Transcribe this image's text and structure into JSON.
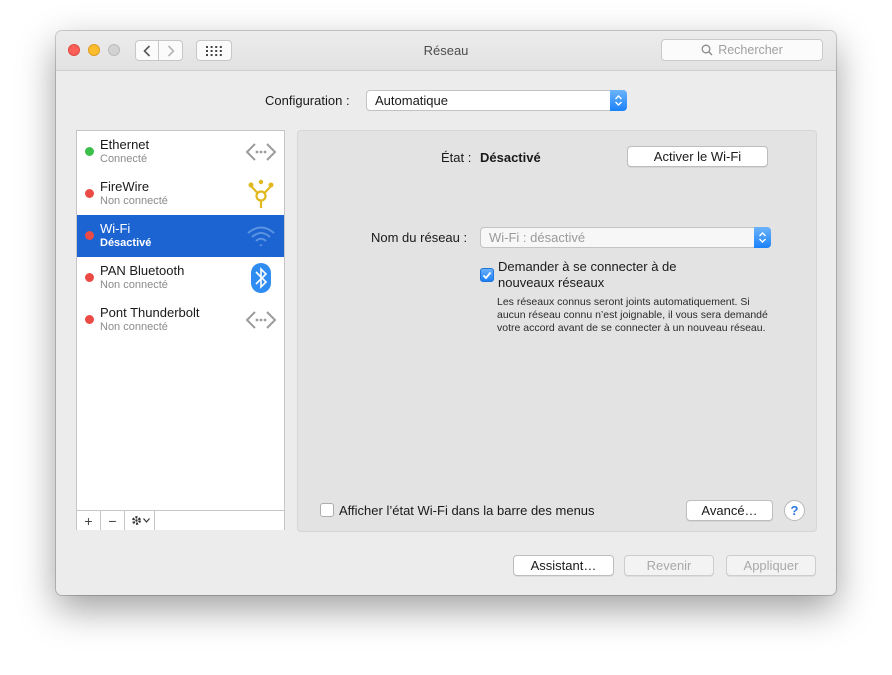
{
  "window": {
    "title": "Réseau",
    "search_placeholder": "Rechercher"
  },
  "config": {
    "label": "Configuration :",
    "value": "Automatique"
  },
  "services": [
    {
      "name": "Ethernet",
      "status": "Connecté",
      "dot_color": "#3bbf4a",
      "icon": "ethernet-arrows-icon"
    },
    {
      "name": "FireWire",
      "status": "Non connecté",
      "dot_color": "#ec4b45",
      "icon": "firewire-icon"
    },
    {
      "name": "Wi-Fi",
      "status": "Désactivé",
      "dot_color": "#ec4b45",
      "icon": "wifi-icon",
      "selected": true
    },
    {
      "name": "PAN Bluetooth",
      "status": "Non connecté",
      "dot_color": "#ec4b45",
      "icon": "bluetooth-icon"
    },
    {
      "name": "Pont Thunderbolt",
      "status": "Non connecté",
      "dot_color": "#ec4b45",
      "icon": "thunderbolt-bridge-arrows-icon"
    }
  ],
  "list_toolbar": {
    "add": "+",
    "remove": "−"
  },
  "detail": {
    "state_label": "État :",
    "state_value": "Désactivé",
    "activate_button": "Activer le Wi-Fi",
    "network_name_label": "Nom du réseau :",
    "network_name_value": "Wi-Fi : désactivé",
    "ask_join_line1": "Demander à se connecter à de",
    "ask_join_line2": "nouveaux réseaux",
    "ask_join_checked": true,
    "note_line1": "Les réseaux connus seront joints automatiquement. Si",
    "note_line2": "aucun réseau connu n’est joignable, il vous sera demandé",
    "note_line3": "votre accord avant de se connecter à un nouveau réseau.",
    "show_status_label": "Afficher l’état Wi-Fi dans la barre des menus",
    "show_status_checked": false,
    "advanced_button": "Avancé…",
    "help_button": "?"
  },
  "footer": {
    "assistant_button": "Assistant…",
    "revert_button": "Revenir",
    "apply_button": "Appliquer"
  },
  "colors": {
    "selection": "#1b64d1",
    "accent": "#1a82fb"
  }
}
